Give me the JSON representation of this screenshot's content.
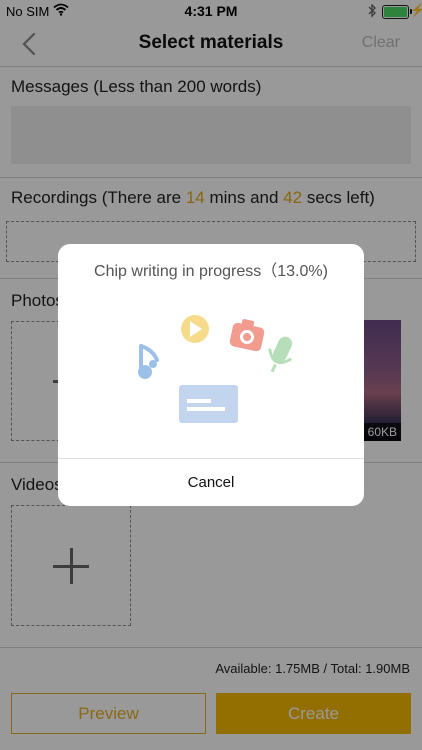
{
  "status_bar": {
    "carrier": "No SIM",
    "time": "4:31 PM"
  },
  "nav": {
    "title": "Select materials",
    "clear_label": "Clear"
  },
  "messages": {
    "label": "Messages (Less than 200 words)"
  },
  "recordings": {
    "prefix": "Recordings (There are ",
    "mins": "14",
    "middle": " mins and ",
    "secs": "42",
    "suffix": " secs left)"
  },
  "photos": {
    "label": "Photos",
    "thumb_size": "60KB"
  },
  "videos": {
    "label": "Videos"
  },
  "footer": {
    "storage_info": "Available: 1.75MB / Total: 1.90MB",
    "preview_label": "Preview",
    "create_label": "Create"
  },
  "dialog": {
    "message": "Chip writing in progress（13.0%)",
    "cancel_label": "Cancel"
  },
  "colors": {
    "accent": "#f5b800",
    "highlight": "#e6a817",
    "battery": "#4cd964"
  },
  "icons": [
    "wifi-icon",
    "bluetooth-icon",
    "battery-icon",
    "back-chevron-icon",
    "plus-icon",
    "music-note-icon",
    "play-icon",
    "camera-icon",
    "microphone-icon",
    "card-icon"
  ]
}
